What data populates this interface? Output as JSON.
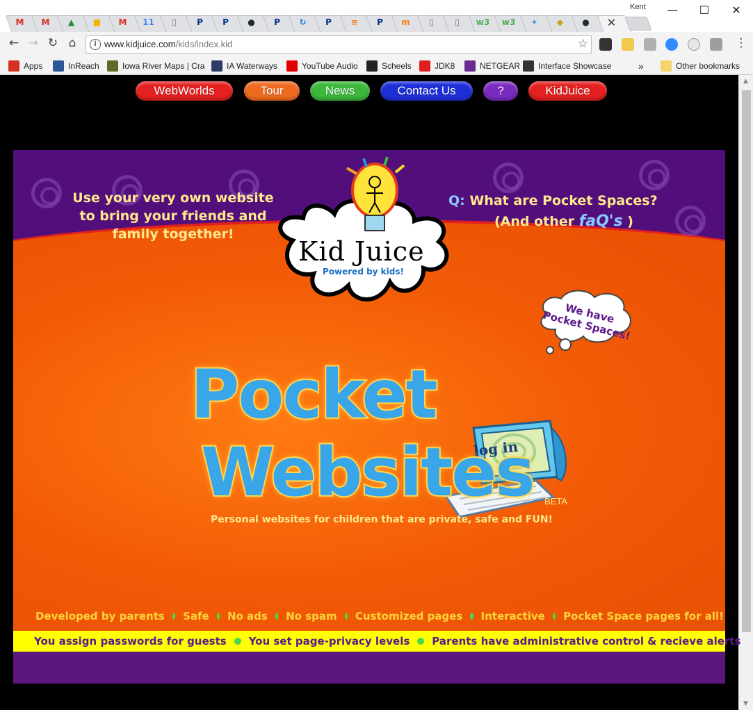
{
  "browser": {
    "profile_name": "Kent",
    "tabs": [
      {
        "icon": "gmail-icon",
        "glyph": "M",
        "color": "#d93025"
      },
      {
        "icon": "gmail-icon",
        "glyph": "M",
        "color": "#d93025"
      },
      {
        "icon": "google-drive-icon",
        "glyph": "▲",
        "color": "#1e8e3e"
      },
      {
        "icon": "google-slides-icon",
        "glyph": "■",
        "color": "#f4b400"
      },
      {
        "icon": "gmail-icon",
        "glyph": "M",
        "color": "#d93025"
      },
      {
        "icon": "google-calendar-icon",
        "glyph": "11",
        "color": "#4285f4"
      },
      {
        "icon": "document-icon",
        "glyph": "▯",
        "color": "#777777"
      },
      {
        "icon": "paypal-icon",
        "glyph": "P",
        "color": "#003087"
      },
      {
        "icon": "paypal-icon",
        "glyph": "P",
        "color": "#003087"
      },
      {
        "icon": "github-icon",
        "glyph": "●",
        "color": "#24292e"
      },
      {
        "icon": "paypal-icon",
        "glyph": "P",
        "color": "#003087"
      },
      {
        "icon": "sync-icon",
        "glyph": "↻",
        "color": "#1a73e8"
      },
      {
        "icon": "paypal-icon",
        "glyph": "P",
        "color": "#003087"
      },
      {
        "icon": "stackoverflow-icon",
        "glyph": "≡",
        "color": "#f48024"
      },
      {
        "icon": "paypal-icon",
        "glyph": "P",
        "color": "#003087"
      },
      {
        "icon": "moodle-icon",
        "glyph": "m",
        "color": "#f98012"
      },
      {
        "icon": "document-icon",
        "glyph": "▯",
        "color": "#777777"
      },
      {
        "icon": "document-icon",
        "glyph": "▯",
        "color": "#777777"
      },
      {
        "icon": "w3-icon",
        "glyph": "w3",
        "color": "#4caf50"
      },
      {
        "icon": "w3-icon",
        "glyph": "w3",
        "color": "#4caf50"
      },
      {
        "icon": "puzzle-icon",
        "glyph": "✦",
        "color": "#4a90d9"
      },
      {
        "icon": "fruit-icon",
        "glyph": "◆",
        "color": "#c8a020"
      },
      {
        "icon": "github-icon",
        "glyph": "●",
        "color": "#24292e"
      }
    ],
    "active_tab_close": "✕",
    "window": {
      "minimize": "—",
      "maximize": "☐",
      "close": "✕"
    },
    "url_host": "www.kidjuice.com",
    "url_path": "/kids/index.kid",
    "bookmarks": [
      {
        "label": "Apps",
        "icon": "apps-grid-icon",
        "color": "#d93025"
      },
      {
        "label": "InReach",
        "icon": "globe-icon",
        "color": "#2b5797"
      },
      {
        "label": "Iowa River Maps | Cra",
        "icon": "map-icon",
        "color": "#5a6b2a"
      },
      {
        "label": "IA Waterways",
        "icon": "grid-icon",
        "color": "#2b3a67"
      },
      {
        "label": "YouTube Audio",
        "icon": "youtube-icon",
        "color": "#e00000"
      },
      {
        "label": "Scheels",
        "icon": "scheels-icon",
        "color": "#222222"
      },
      {
        "label": "JDK8",
        "icon": "oracle-icon",
        "color": "#e0201f"
      },
      {
        "label": "NETGEAR",
        "icon": "netgear-icon",
        "color": "#6b2c91"
      },
      {
        "label": "Interface Showcase",
        "icon": "panda-icon",
        "color": "#333333"
      }
    ],
    "bookmarks_overflow": "»",
    "other_bookmarks": "Other bookmarks"
  },
  "nav": [
    {
      "label": "WebWorlds",
      "color": "#e52020",
      "name": "nav-webworlds-button"
    },
    {
      "label": "Tour",
      "color": "#ee6a1f",
      "name": "nav-tour-button"
    },
    {
      "label": "News",
      "color": "#3cb83a",
      "name": "nav-news-button"
    },
    {
      "label": "Contact Us",
      "color": "#1f2fd8",
      "name": "nav-contact-us-button"
    },
    {
      "label": "?",
      "color": "#7a2bc0",
      "name": "nav-help-button"
    },
    {
      "label": "KidJuice",
      "color": "#e52020",
      "name": "nav-kidjuice-button"
    }
  ],
  "hero": {
    "tagline_lines": [
      "Use your very own website",
      "to bring your friends and",
      "family together!"
    ],
    "faq_q": "Q:",
    "faq_line1": "What are Pocket Spaces?",
    "faq_open": "(And other ",
    "faq_word": "faQ's",
    "faq_close": " )",
    "logo_title": "Kid Juice",
    "logo_tagline": "Powered by kids!",
    "bubble_text": "We have Pocket Spaces!",
    "login_label": "log in",
    "title_line1": "Pocket",
    "title_line2": "Websites",
    "beta": "BETA",
    "subtitle": "Personal websites for children that are private, safe and FUN!"
  },
  "features": [
    "Developed by parents",
    "Safe",
    "No ads",
    "No spam",
    "Customized pages",
    "Interactive",
    "Pocket Space pages for all!"
  ],
  "bar_items": [
    "You assign passwords for guests",
    "You set page-privacy levels",
    "Parents have administrative control & recieve alerts"
  ],
  "colors": {
    "page_bg": "#000000",
    "purple": "#520f7c",
    "orange": "#f25a06",
    "yellow_bar": "#ffff00",
    "feature_text": "#ffd43a",
    "dot_green": "#49d84a"
  }
}
